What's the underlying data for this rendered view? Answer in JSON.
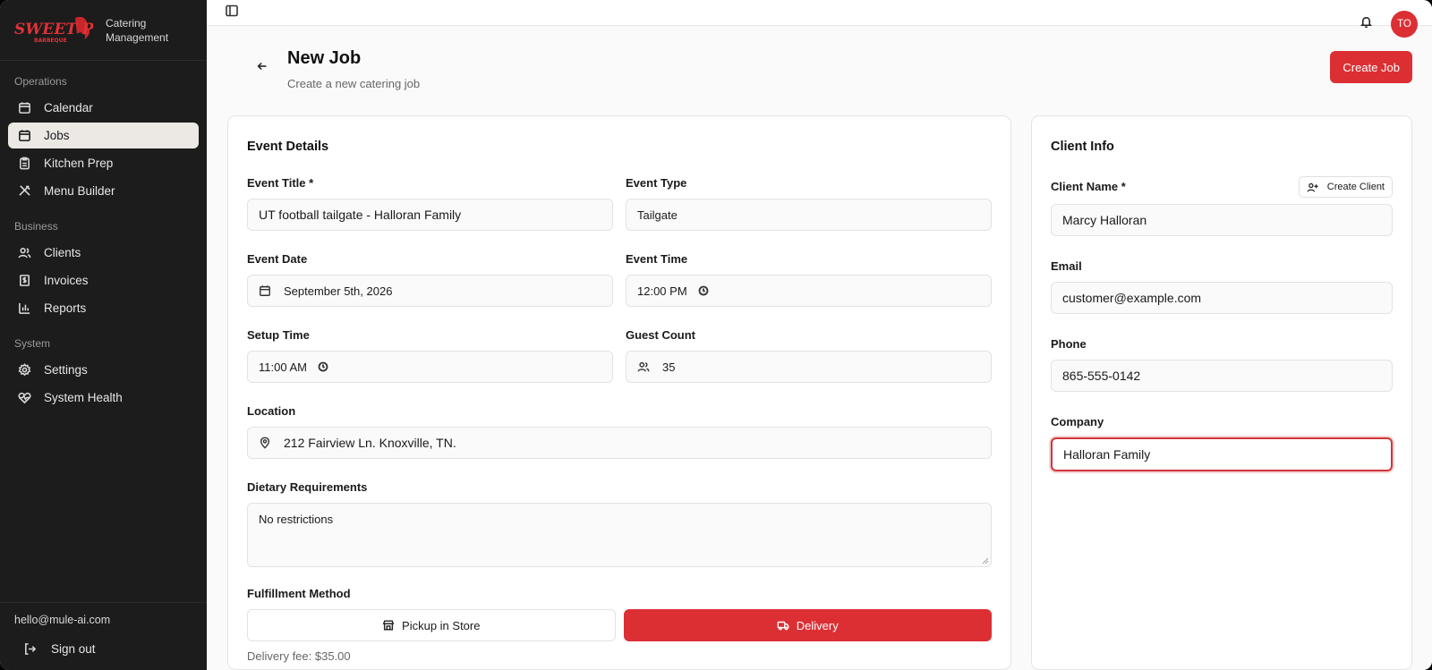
{
  "brand": {
    "logo_text": "SWEET P'S",
    "logo_sub": "BARBEQUE",
    "subtitle_line1": "Catering",
    "subtitle_line2": "Management"
  },
  "sidebar": {
    "sections": [
      {
        "heading": "Operations",
        "items": [
          {
            "label": "Calendar",
            "icon": "calendar-icon"
          },
          {
            "label": "Jobs",
            "icon": "calendar-icon",
            "active": true
          },
          {
            "label": "Kitchen Prep",
            "icon": "clipboard-icon"
          },
          {
            "label": "Menu Builder",
            "icon": "utensils-icon"
          }
        ]
      },
      {
        "heading": "Business",
        "items": [
          {
            "label": "Clients",
            "icon": "users-icon"
          },
          {
            "label": "Invoices",
            "icon": "receipt-icon"
          },
          {
            "label": "Reports",
            "icon": "bar-chart-icon"
          }
        ]
      },
      {
        "heading": "System",
        "items": [
          {
            "label": "Settings",
            "icon": "gear-icon"
          },
          {
            "label": "System Health",
            "icon": "heart-pulse-icon"
          }
        ]
      }
    ],
    "user_email": "hello@mule-ai.com",
    "signout_label": "Sign out"
  },
  "topbar": {
    "avatar_initials": "TO"
  },
  "page": {
    "title": "New Job",
    "subtitle": "Create a new catering job",
    "create_button": "Create Job"
  },
  "event": {
    "title": "Event Details",
    "event_title_label": "Event Title *",
    "event_title_value": "UT football tailgate - Halloran Family",
    "event_type_label": "Event Type",
    "event_type_value": "Tailgate",
    "event_date_label": "Event Date",
    "event_date_value": "September 5th, 2026",
    "event_time_label": "Event Time",
    "event_time_value": "12:00 PM",
    "setup_time_label": "Setup Time",
    "setup_time_value": "11:00 AM",
    "guest_count_label": "Guest Count",
    "guest_count_value": "35",
    "location_label": "Location",
    "location_value": "212 Fairview Ln. Knoxville, TN.",
    "dietary_label": "Dietary Requirements",
    "dietary_value": "No restrictions",
    "fulfillment_label": "Fulfillment Method",
    "pickup_label": "Pickup in Store",
    "delivery_label": "Delivery",
    "delivery_fee": "Delivery fee: $35.00"
  },
  "client": {
    "title": "Client Info",
    "name_label": "Client Name *",
    "create_client_label": "Create Client",
    "name_value": "Marcy Halloran",
    "email_label": "Email",
    "email_value": "customer@example.com",
    "phone_label": "Phone",
    "phone_value": "865-555-0142",
    "company_label": "Company",
    "company_value": "Halloran Family"
  },
  "colors": {
    "accent": "#dc2f34",
    "sidebar_bg": "#1c1c1c",
    "active_item_bg": "#ece9e5"
  }
}
